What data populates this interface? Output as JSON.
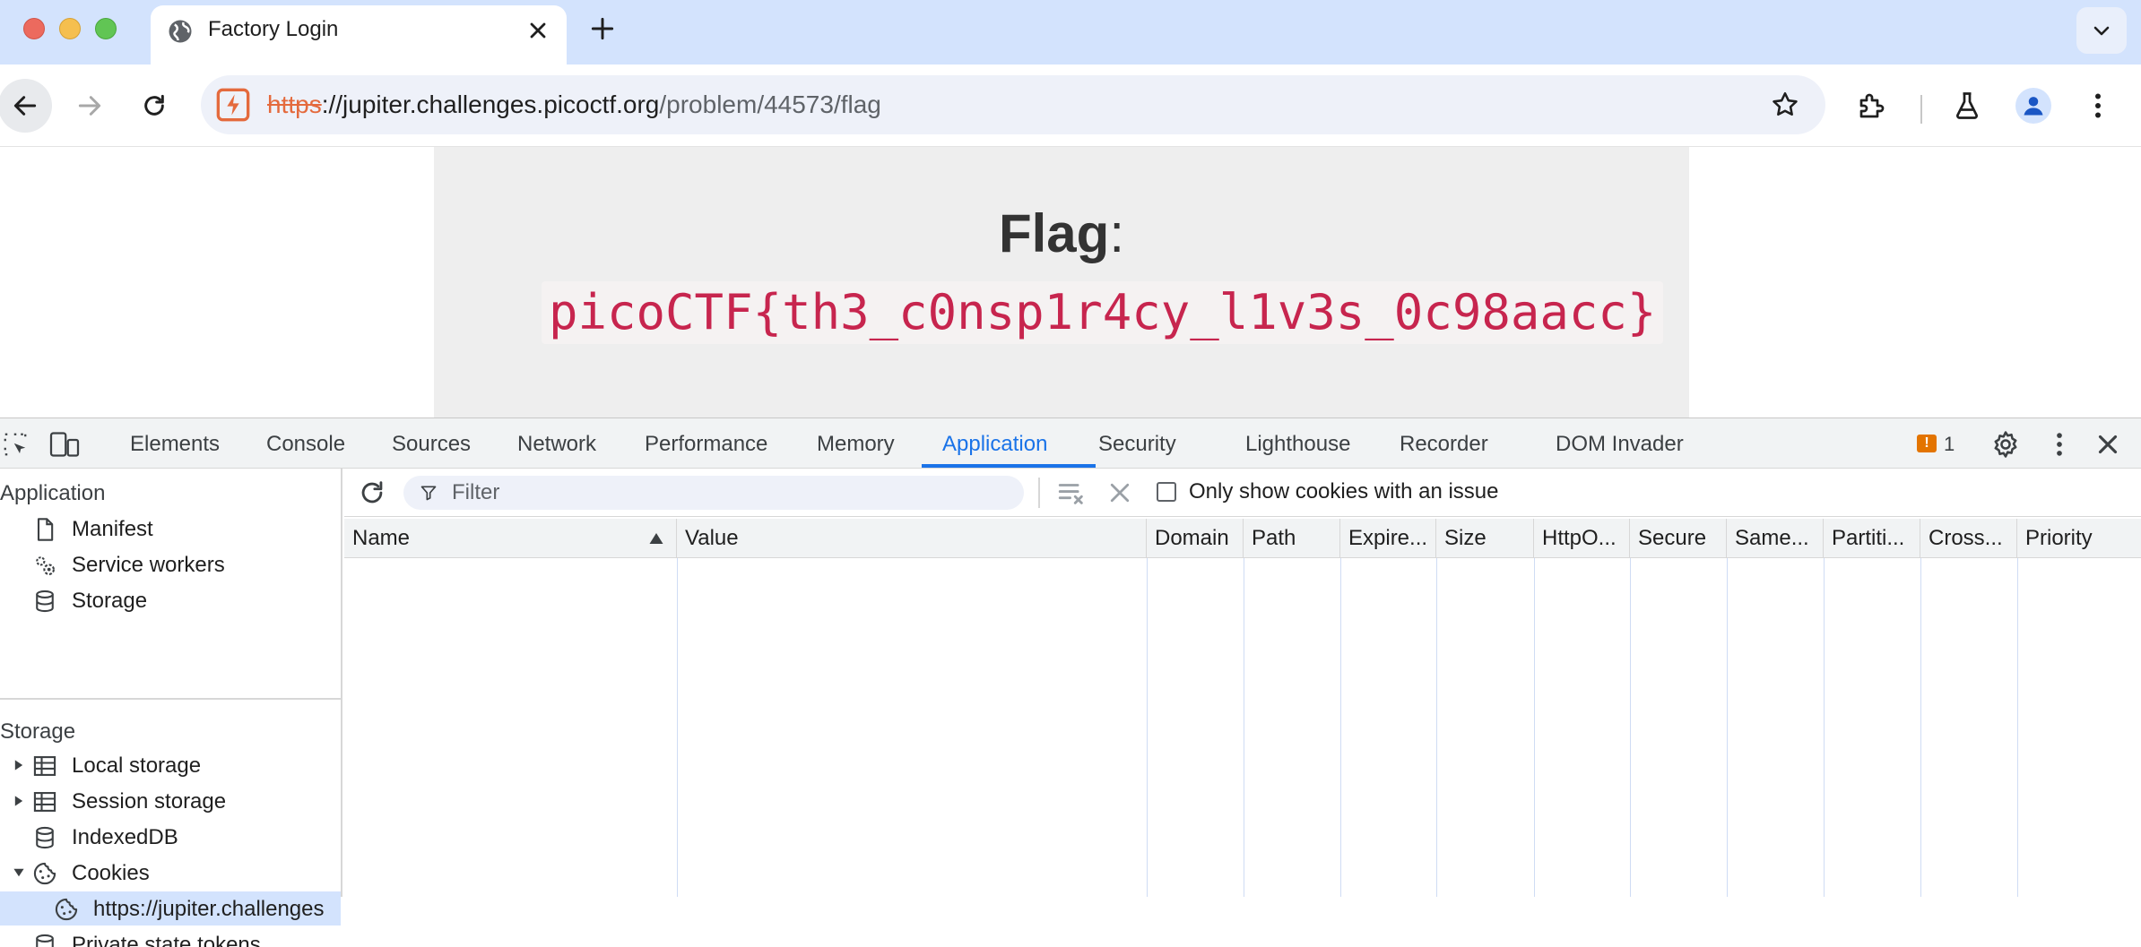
{
  "browser": {
    "tab_title": "Factory Login",
    "url": {
      "scheme": "https",
      "host_sep": "://",
      "host": "jupiter.challenges.picoctf.org",
      "path": "/problem/44573/flag"
    }
  },
  "page": {
    "heading": "Flag",
    "heading_suffix": ":",
    "flag_value": "picoCTF{th3_c0nsp1r4cy_l1v3s_0c98aacc}"
  },
  "devtools": {
    "tabs": [
      "Elements",
      "Console",
      "Sources",
      "Network",
      "Performance",
      "Memory",
      "Application",
      "Security",
      "Lighthouse",
      "Recorder",
      "DOM Invader"
    ],
    "active_tab": "Application",
    "issues_count": "1",
    "sidebar": {
      "application_header": "Application",
      "application_items": [
        "Manifest",
        "Service workers",
        "Storage"
      ],
      "storage_header": "Storage",
      "storage_items": [
        "Local storage",
        "Session storage",
        "IndexedDB",
        "Cookies"
      ],
      "cookie_origin": "https://jupiter.challenges",
      "partial_item": "Private state tokens"
    },
    "cookies": {
      "filter_placeholder": "Filter",
      "only_issues_label": "Only show cookies with an issue",
      "columns": [
        "Name",
        "Value",
        "Domain",
        "Path",
        "Expire...",
        "Size",
        "HttpO...",
        "Secure",
        "Same...",
        "Partiti...",
        "Cross...",
        "Priority"
      ]
    }
  },
  "colors": {
    "tabstrip": "#d3e3fd",
    "accent": "#1a73e8",
    "flag_text": "#c7254e",
    "insecure_scheme": "#e46a3d"
  }
}
